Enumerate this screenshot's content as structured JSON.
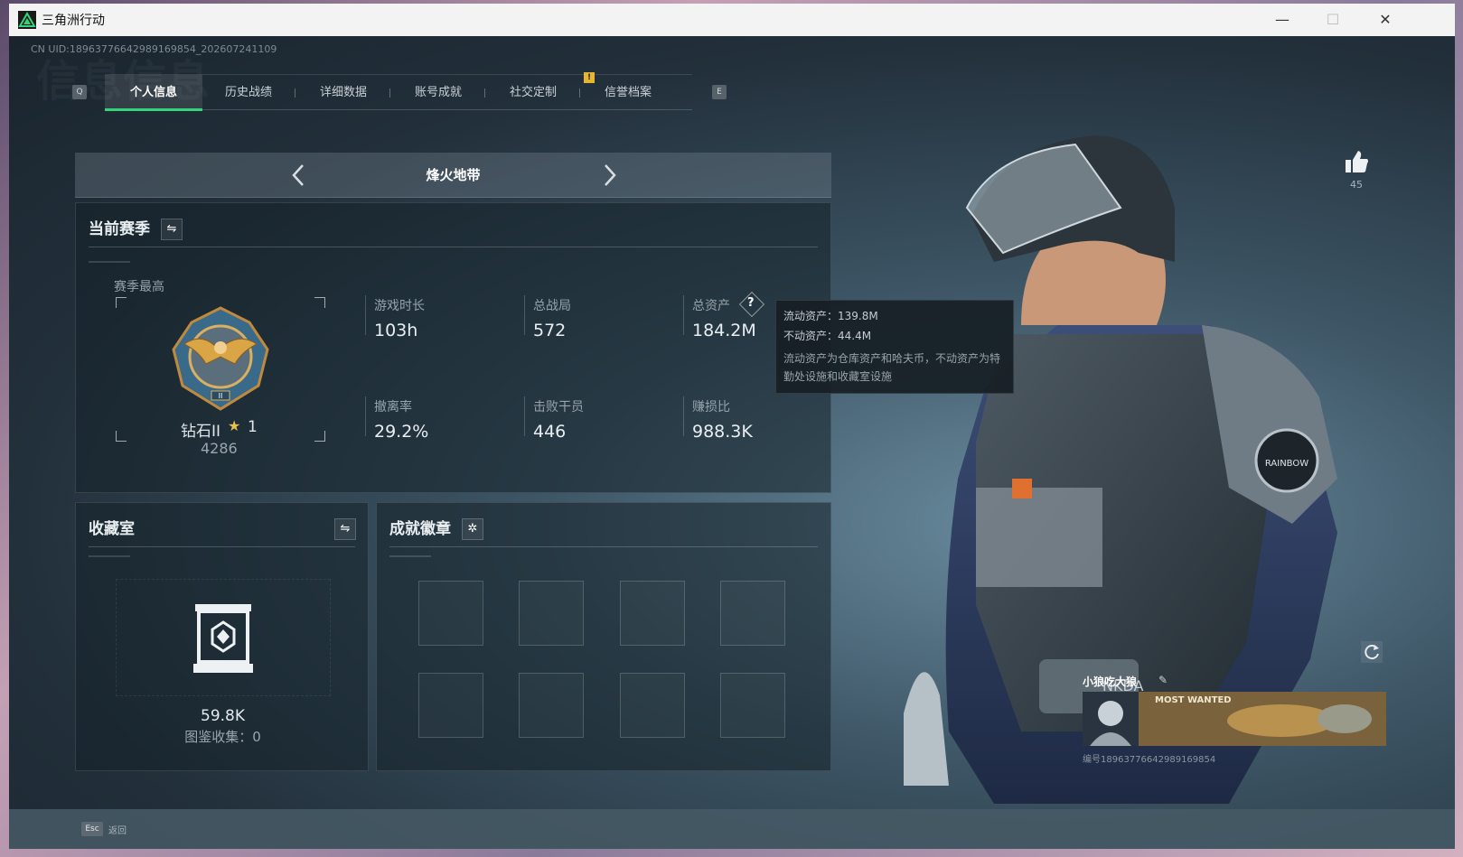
{
  "window": {
    "title": "三角洲行动"
  },
  "header": {
    "uid": "CN UID:18963776642989169854_202607241109",
    "bg_title": "信息信息"
  },
  "tabs": [
    {
      "label": "个人信息",
      "active": true
    },
    {
      "label": "历史战绩"
    },
    {
      "label": "详细数据"
    },
    {
      "label": "账号成就"
    },
    {
      "label": "社交定制"
    },
    {
      "label": "信誉档案"
    }
  ],
  "keyhints": {
    "left": "Q",
    "right": "E"
  },
  "notif": "!",
  "mode": {
    "title": "烽火地带"
  },
  "season": {
    "title": "当前赛季",
    "best_label": "赛季最高",
    "rank_name": "钻石II",
    "rank_star_count": "1",
    "rank_points": "4286",
    "stats": [
      {
        "label": "游戏时长",
        "value": "103h"
      },
      {
        "label": "总战局",
        "value": "572"
      },
      {
        "label": "总资产",
        "value": "184.2M"
      },
      {
        "label": "撤离率",
        "value": "29.2%"
      },
      {
        "label": "击败干员",
        "value": "446"
      },
      {
        "label": "赚损比",
        "value": "988.3K"
      }
    ]
  },
  "tooltip": {
    "liquid": "流动资产：139.8M",
    "fixed": "不动资产：44.4M",
    "desc": "流动资产为仓库资产和哈夫币，不动资产为特勤处设施和收藏室设施"
  },
  "collection": {
    "title": "收藏室",
    "value": "59.8K",
    "catalog": "图鉴收集：0"
  },
  "badges": {
    "title": "成就徽章"
  },
  "like": {
    "count": "45"
  },
  "card": {
    "name": "小狼吃大狼",
    "banner_text": "MOST WANTED",
    "id": "编号18963776642989169854"
  },
  "footer": {
    "esc_key": "Esc",
    "esc_label": "返回"
  },
  "colors": {
    "accent": "#36d47a",
    "bg": "#1c2731",
    "tooltip_bg": "#161e24",
    "gold": "#e6b532"
  }
}
